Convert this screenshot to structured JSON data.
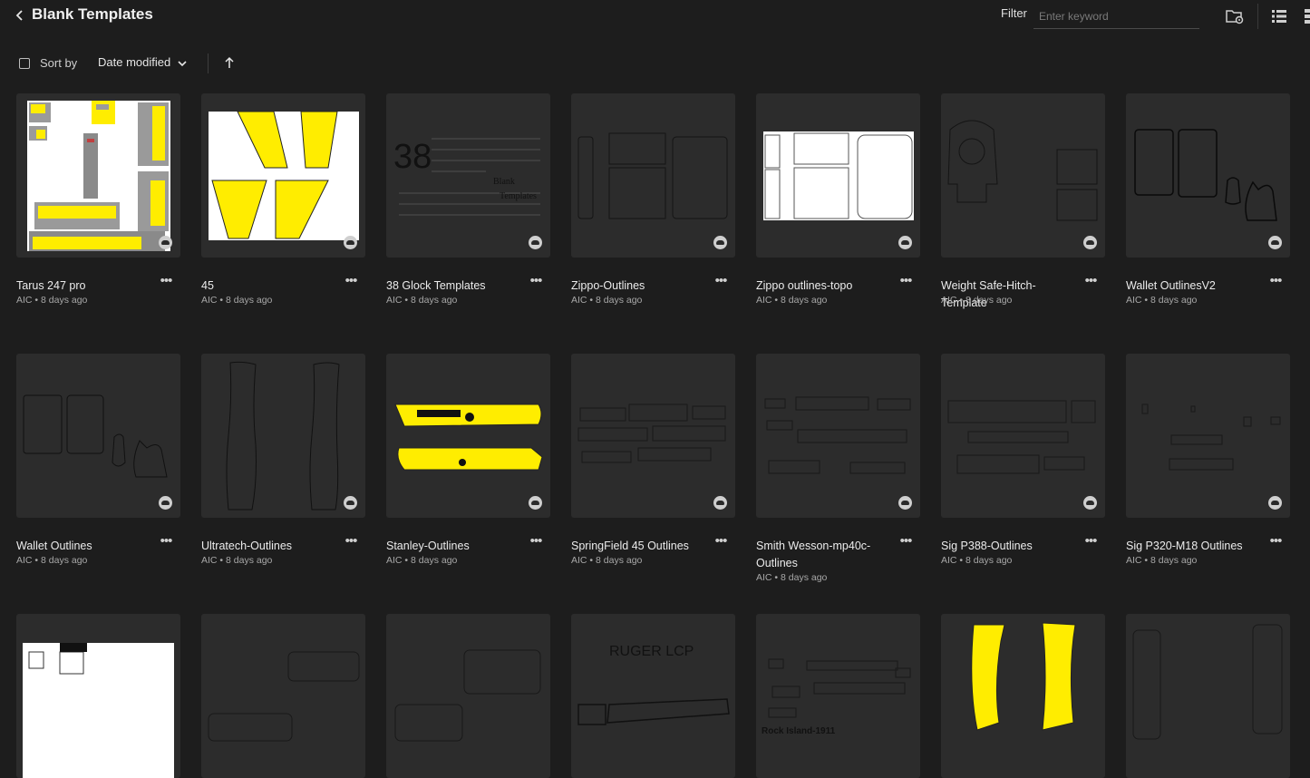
{
  "header": {
    "title": "Blank Templates",
    "filter_label": "Filter",
    "filter_placeholder": "Enter keyword",
    "icons": [
      "back-chevron-icon",
      "folder-settings-icon",
      "list-view-icon",
      "grid-view-icon"
    ]
  },
  "sortbar": {
    "sort_label": "Sort by",
    "sort_value": "Date modified",
    "direction": "ascending"
  },
  "cards": [
    {
      "name": "Tarus 247 pro",
      "meta": "AIC • 8 days ago"
    },
    {
      "name": "45",
      "meta": "AIC • 8 days ago"
    },
    {
      "name": "38 Glock Templates",
      "meta": "AIC • 8 days ago"
    },
    {
      "name": "Zippo-Outlines",
      "meta": "AIC • 8 days ago"
    },
    {
      "name": "Zippo outlines-topo",
      "meta": "AIC • 8 days ago"
    },
    {
      "name": "Weight Safe-Hitch-Template",
      "meta": "AIC • 8 days ago"
    },
    {
      "name": "Wallet OutlinesV2",
      "meta": "AIC • 8 days ago"
    },
    {
      "name": "Wallet Outlines",
      "meta": "AIC • 8 days ago"
    },
    {
      "name": "Ultratech-Outlines",
      "meta": "AIC • 8 days ago"
    },
    {
      "name": "Stanley-Outlines",
      "meta": "AIC • 8 days ago"
    },
    {
      "name": "SpringField 45 Outlines",
      "meta": "AIC • 8 days ago"
    },
    {
      "name": "Smith Wesson-mp40c-Outlines",
      "meta": "AIC • 8 days ago"
    },
    {
      "name": "Sig P388-Outlines",
      "meta": "AIC • 8 days ago"
    },
    {
      "name": "Sig P320-M18 Outlines",
      "meta": "AIC • 8 days ago"
    }
  ],
  "thumb_text": {
    "glock_num": "38",
    "glock_word1": "Blank",
    "glock_word2": "Templates",
    "ruger": "RUGER LCP",
    "rock": "Rock Island-1911"
  },
  "colors": {
    "background": "#1d1d1d",
    "thumb_bg": "#2c2c2c",
    "accent_yellow": "#ffed00"
  }
}
